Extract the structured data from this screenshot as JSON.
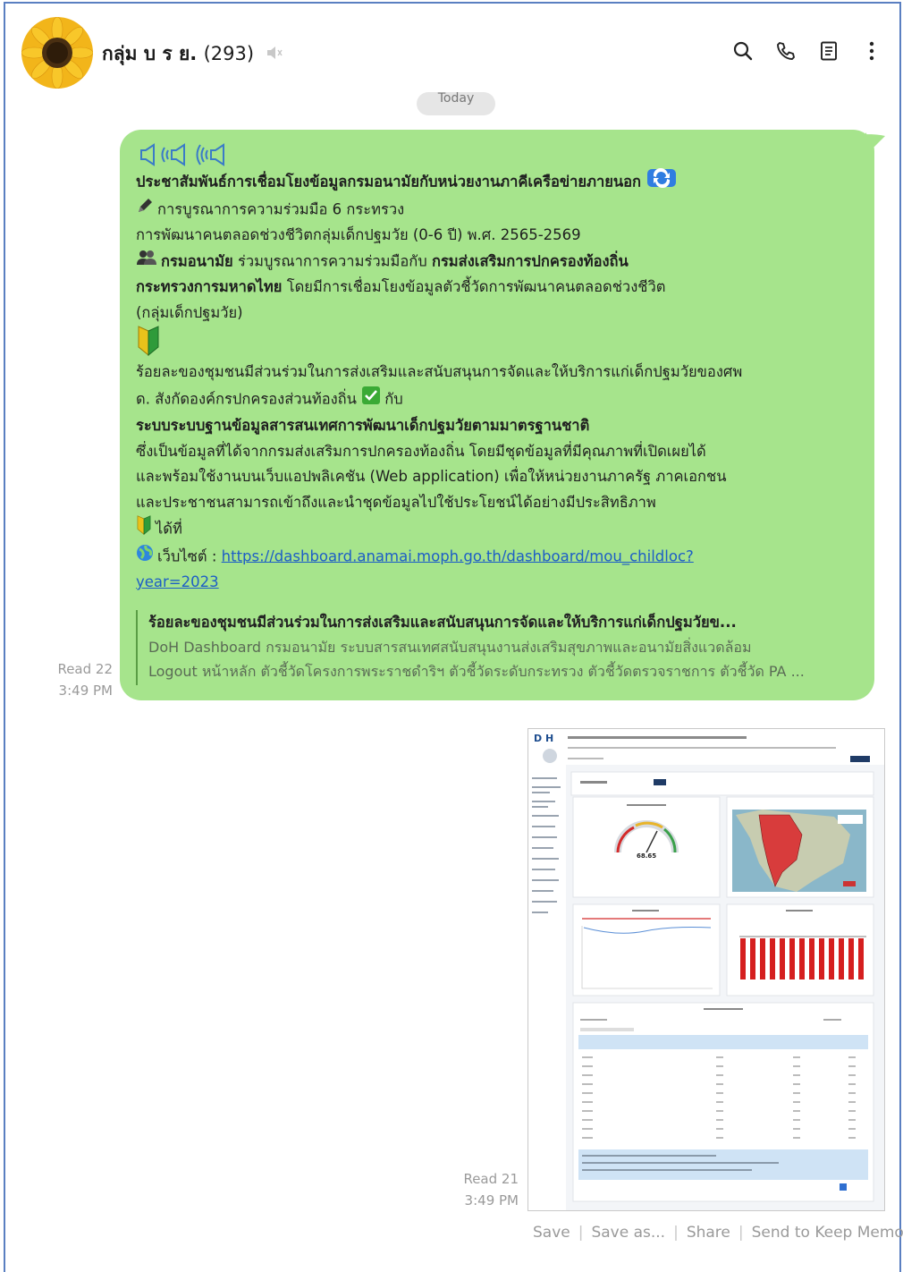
{
  "header": {
    "group_name": "กลุ่ม บ ร ย.",
    "member_count": "(293)",
    "icons": [
      "search-icon",
      "phone-icon",
      "notes-icon",
      "more-vertical-icon"
    ]
  },
  "date_divider": "Today",
  "message1": {
    "headline": "ประชาสัมพันธ์การเชื่อมโยงข้อมูลกรมอนามัยกับหน่วยงานภาคีเครือข่ายภายนอก",
    "line1": "การบูรณาการความร่วมมือ 6 กระทรวง",
    "line2": "การพัฒนาคนตลอดช่วงชีวิตกลุ่มเด็กปฐมวัย (0-6 ปี) พ.ศ. 2565-2569",
    "line3_bold1": "กรมอนามัย",
    "line3_text": " ร่วมบูรณาการความร่วมมือกับ ",
    "line3_bold2": "กรมส่งเสริมการปกครองท้องถิ่น",
    "line4_bold": "กระทรวงการมหาดไทย",
    "line4_text": " โดยมีการเชื่อมโยงข้อมูลตัวชี้วัดการพัฒนาคนตลอดช่วงชีวิต",
    "line5": "(กลุ่มเด็กปฐมวัย)",
    "line6": "ร้อยละของชุมชนมีส่วนร่วมในการส่งเสริมและสนับสนุนการจัดและให้บริการแก่เด็กปฐมวัยของศพ",
    "line7a": "ด. สังกัดองค์กรปกครองส่วนท้องถิ่น",
    "line7b": "กับ",
    "line8": "ระบบระบบฐานข้อมูลสารสนเทศการพัฒนาเด็กปฐมวัยตามมาตรฐานชาติ",
    "line9": "ซึ่งเป็นข้อมูลที่ได้จากกรมส่งเสริมการปกครองท้องถิ่น โดยมีชุดข้อมูลที่มีคุณภาพที่เปิดเผยได้",
    "line10": "และพร้อมใช้งานบนเว็บแอปพลิเคชัน (Web application) เพื่อให้หน่วยงานภาครัฐ ภาคเอกชน",
    "line11": "และประชาชนสามารถเข้าถึงและนำชุดข้อมูลไปใช้ประโยชน์ได้อย่างมีประสิทธิภาพ",
    "line12": "ได้ที่",
    "website_label": "เว็บไซต์ :",
    "link_part1": "https://dashboard.anamai.moph.go.th/dashboard/mou_childloc?",
    "link_part2": "year=2023",
    "preview_title": "ร้อยละของชุมชนมีส่วนร่วมในการส่งเสริมและสนับสนุนการจัดและให้บริการแก่เด็กปฐมวัยข...",
    "preview_desc1": "DoH Dashboard กรมอนามัย ระบบสารสนเทศสนับสนุนงานส่งเสริมสุขภาพและอนามัยสิ่งแวดล้อม",
    "preview_desc2": "Logout หน้าหลัก ตัวชี้วัดโครงการพระราชดำริฯ ตัวชี้วัดระดับกระทรวง ตัวชี้วัดตรวจราชการ ตัวชี้วัด PA ...",
    "read_status": "Read 22",
    "time": "3:49 PM"
  },
  "message2": {
    "read_status": "Read 21",
    "time": "3:49 PM",
    "screenshot": {
      "logo": "D H",
      "gauge_value": "68.65"
    }
  },
  "actions": {
    "save": "Save",
    "save_as": "Save as...",
    "share": "Share",
    "keep": "Send to Keep Memo"
  },
  "colors": {
    "bubble": "#a6e48c",
    "link": "#1d5ec6",
    "frame": "#5a7fc1"
  }
}
